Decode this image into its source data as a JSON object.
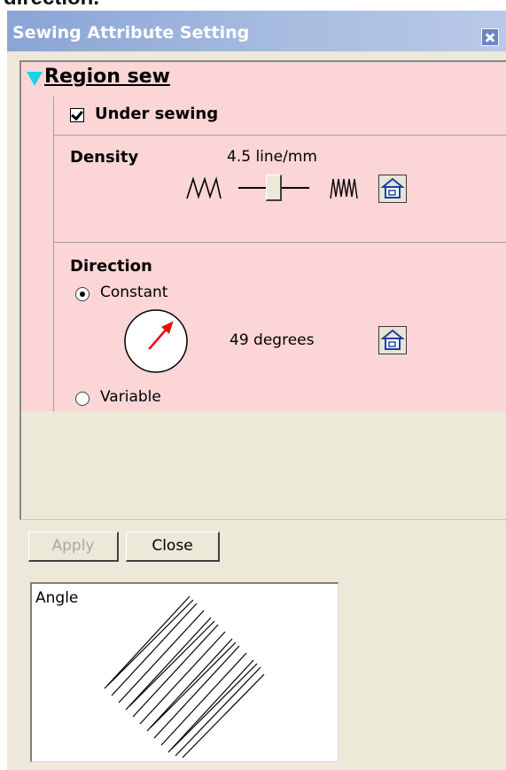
{
  "cropped_text": "direction.",
  "window": {
    "title": "Sewing Attribute Setting",
    "close_icon": "close-icon"
  },
  "region": {
    "label": "Region sew",
    "expand_icon": "triangle-down-icon"
  },
  "under_sewing": {
    "label": "Under sewing",
    "checked": true
  },
  "density": {
    "label": "Density",
    "value_text": "4.5 line/mm",
    "slider_position": 0.5,
    "icons": [
      "sparse-zigzag-icon",
      "dense-zigzag-icon",
      "default-home-icon"
    ]
  },
  "direction": {
    "label": "Direction",
    "options": [
      {
        "label": "Constant",
        "selected": true
      },
      {
        "label": "Variable",
        "selected": false
      }
    ],
    "angle_degrees": 49,
    "value_text": "49 degrees",
    "dial_icon": "angle-dial-icon"
  },
  "buttons": {
    "apply_label": "Apply",
    "apply_enabled": false,
    "close_label": "Close"
  },
  "preview": {
    "label": "Angle"
  },
  "colors": {
    "titlebar_start": "#8aa4d6",
    "titlebar_end": "#b9c9e8",
    "panel_bg": "#fcd5d6",
    "dialog_bg": "#ece9d8",
    "expander": "#19d4e6",
    "dial_arrow": "#e81010",
    "home_icon": "#1a3fa0"
  }
}
